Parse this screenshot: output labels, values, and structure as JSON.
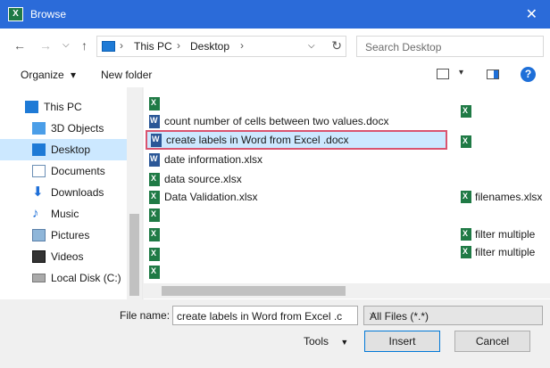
{
  "window": {
    "title": "Browse"
  },
  "navbar": {
    "back": "←",
    "forward": "→",
    "dropdown": "⌵",
    "up": "↑",
    "crumbs": [
      "This PC",
      "Desktop"
    ],
    "separator": "›",
    "address_dropdown": "⌵",
    "refresh": "↻",
    "search_placeholder": "Search Desktop"
  },
  "toolbar": {
    "organize_label": "Organize",
    "organize_dd": "▾",
    "new_folder_label": "New folder",
    "view_dd": "▾",
    "help": "?"
  },
  "sidebar": {
    "items": [
      {
        "label": "This PC",
        "icon": "pc-icon"
      },
      {
        "label": "3D Objects",
        "icon": "cube-icon"
      },
      {
        "label": "Desktop",
        "icon": "desktop-icon",
        "selected": true
      },
      {
        "label": "Documents",
        "icon": "documents-icon"
      },
      {
        "label": "Downloads",
        "icon": "download-icon"
      },
      {
        "label": "Music",
        "icon": "music-icon"
      },
      {
        "label": "Pictures",
        "icon": "pictures-icon"
      },
      {
        "label": "Videos",
        "icon": "videos-icon"
      },
      {
        "label": "Local Disk (C:)",
        "icon": "disk-icon"
      }
    ]
  },
  "files": {
    "rows": [
      {
        "name": "count number of cells between two values.docx",
        "type": "docx"
      },
      {
        "name": "create labels in Word from Excel .docx",
        "type": "docx",
        "selected": true
      },
      {
        "name": "date information.xlsx",
        "type": "xlsx"
      },
      {
        "name": "data source.xlsx",
        "type": "xlsx"
      },
      {
        "name": "Data Validation.xlsx",
        "type": "xlsx"
      }
    ],
    "right_col": [
      {
        "name": "filenames.xlsx",
        "type": "xlsx"
      },
      {
        "name": "filter multiple",
        "type": "xlsx"
      },
      {
        "name": "filter multiple",
        "type": "xlsx"
      }
    ]
  },
  "bottom": {
    "file_name_label": "File name:",
    "file_name_value": "create labels in Word from Excel .c",
    "file_type_value": "All Files (*.*)",
    "file_type_dd": "⌵",
    "tools_label": "Tools",
    "tools_dd": "▼",
    "insert_label": "Insert",
    "cancel_label": "Cancel"
  }
}
